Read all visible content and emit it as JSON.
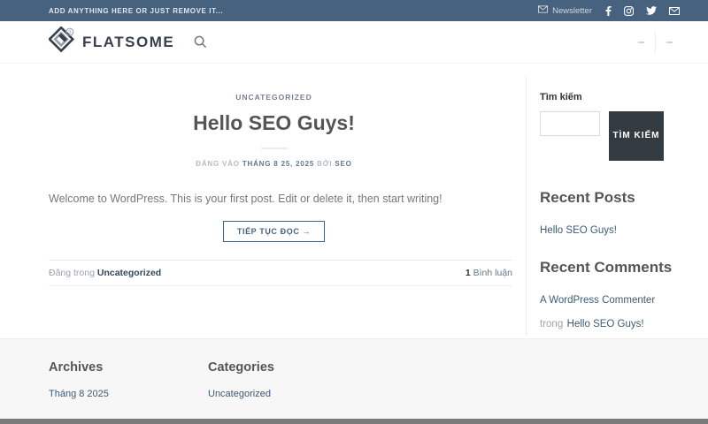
{
  "topbar": {
    "left_text": "ADD ANYTHING HERE OR JUST REMOVE IT...",
    "newsletter_label": "Newsletter",
    "social_icons": [
      "envelope-icon",
      "facebook-icon",
      "instagram-icon",
      "twitter-icon",
      "email-icon"
    ]
  },
  "header": {
    "logo_text": "FLATSOME",
    "icons": [
      "flatsome-diamond-logo-icon",
      "search-icon"
    ]
  },
  "post": {
    "category": "UNCATEGORIZED",
    "title": "Hello SEO Guys!",
    "meta_posted_label": "ĐĂNG VÀO",
    "meta_date": "THÁNG 8 25, 2025",
    "meta_by_label": "BỞI",
    "meta_author": "SEO",
    "excerpt": "Welcome to WordPress. This is your first post. Edit or delete it, then start writing!",
    "read_more_label": "TIẾP TỤC ĐỌC →",
    "posted_in_label": "Đăng trong",
    "posted_in_category": "Uncategorized",
    "comments_count": "1",
    "comments_label": "Bình luận"
  },
  "sidebar": {
    "search_label": "Tìm kiếm",
    "search_button_label": "TÌM KIẾM",
    "search_input_value": "",
    "recent_posts_title": "Recent Posts",
    "recent_posts": [
      "Hello SEO Guys!"
    ],
    "recent_comments_title": "Recent Comments",
    "recent_comments": [
      {
        "author": "A WordPress Commenter",
        "in_label": "trong",
        "post": "Hello SEO Guys!"
      }
    ]
  },
  "footer": {
    "archives_title": "Archives",
    "archives": [
      "Tháng 8 2025"
    ],
    "categories_title": "Categories",
    "categories": [
      "Uncategorized"
    ]
  },
  "colors": {
    "topbar_bg": "#46627f",
    "accent": "#46627f",
    "search_button_bg": "#333a40",
    "heading": "#555555",
    "link": "#3d5a76",
    "footer_bg": "#f7f7f7",
    "bottombar_bg": "#7a7a7a"
  }
}
